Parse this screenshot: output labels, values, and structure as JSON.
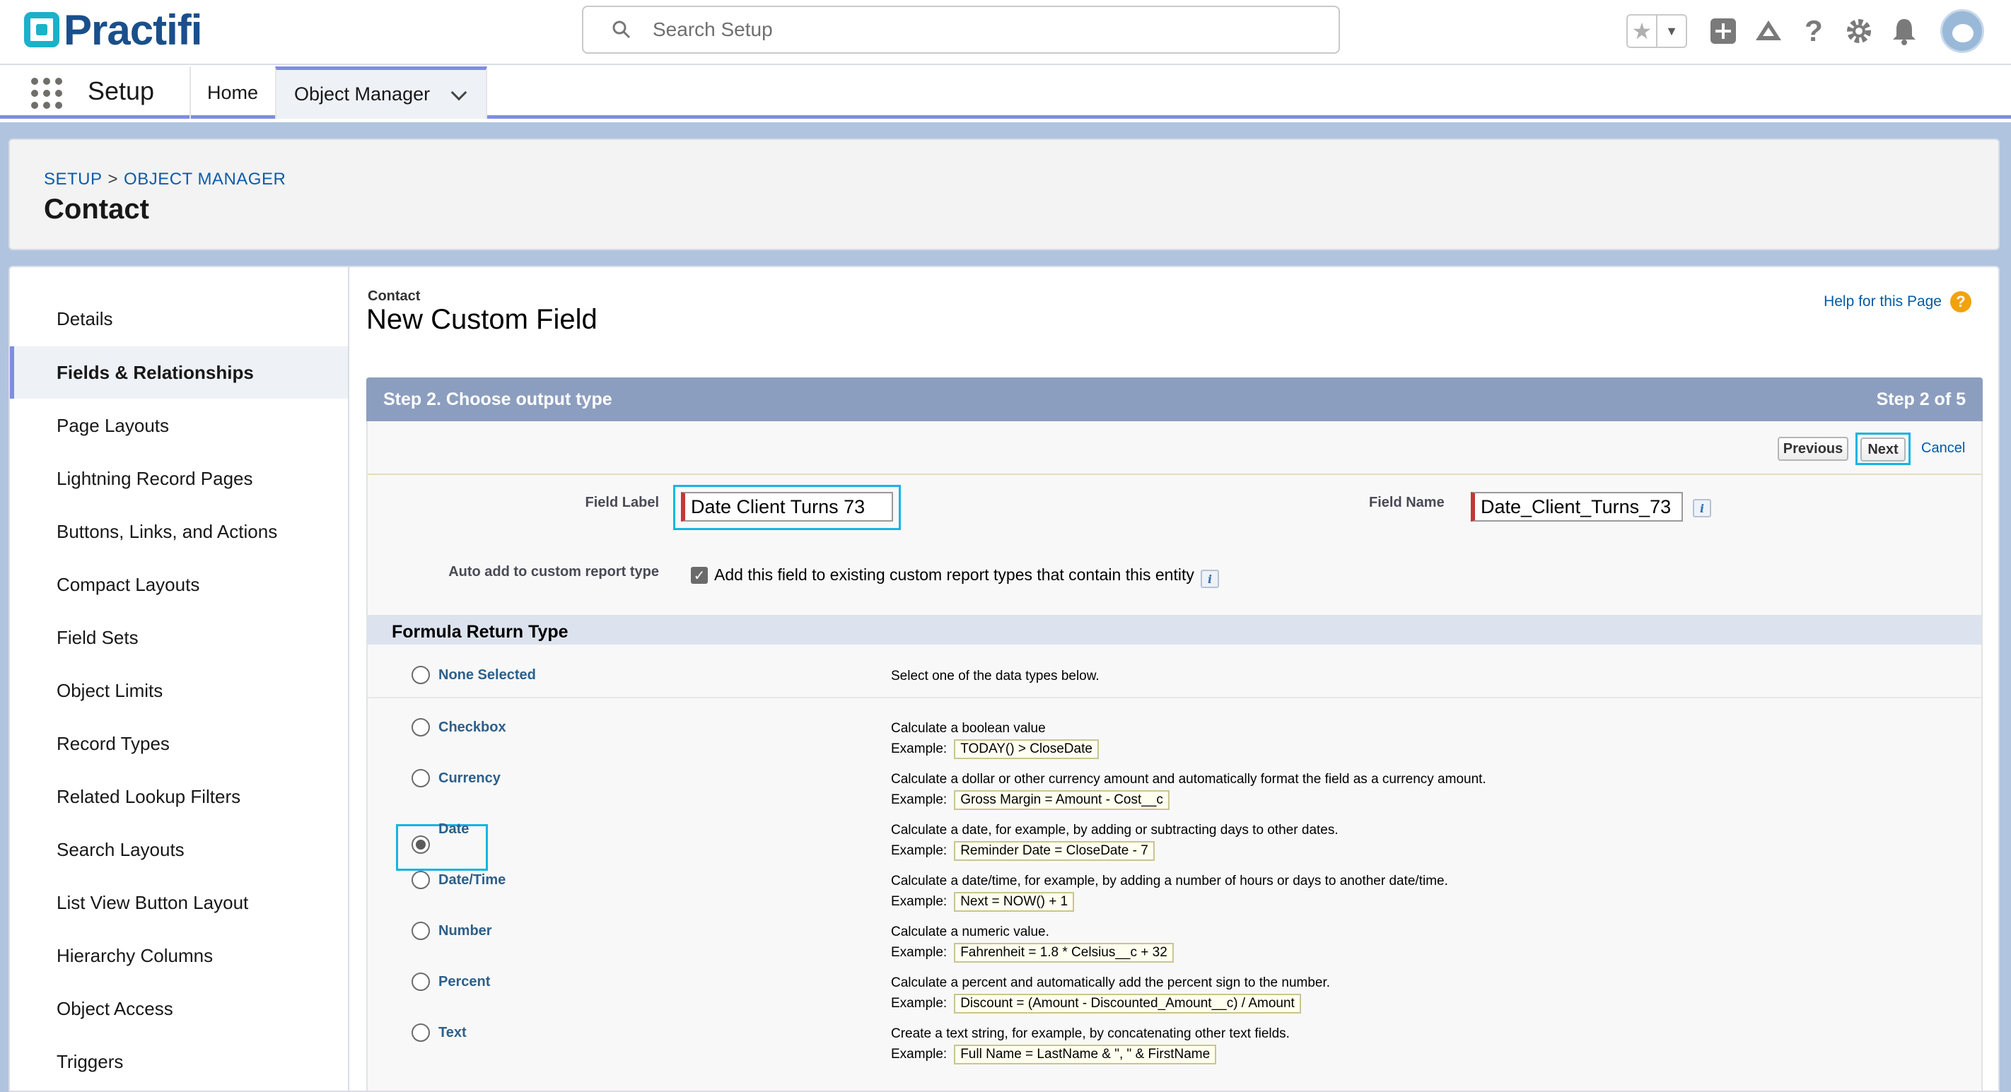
{
  "header": {
    "logo_text": "Practifi",
    "search_placeholder": "Search Setup",
    "icons": [
      "favorites-star-icon",
      "add-icon",
      "trailhead-icon",
      "help-icon",
      "gear-icon",
      "notification-bell-icon",
      "user-avatar"
    ]
  },
  "nav": {
    "app_name": "Setup",
    "tabs": [
      {
        "label": "Home"
      },
      {
        "label": "Object Manager"
      }
    ]
  },
  "page_header": {
    "breadcrumb_setup": "SETUP",
    "breadcrumb_sep": ">",
    "breadcrumb_om": "OBJECT MANAGER",
    "title": "Contact"
  },
  "sidebar": {
    "items": [
      {
        "label": "Details"
      },
      {
        "label": "Fields & Relationships"
      },
      {
        "label": "Page Layouts"
      },
      {
        "label": "Lightning Record Pages"
      },
      {
        "label": "Buttons, Links, and Actions"
      },
      {
        "label": "Compact Layouts"
      },
      {
        "label": "Field Sets"
      },
      {
        "label": "Object Limits"
      },
      {
        "label": "Record Types"
      },
      {
        "label": "Related Lookup Filters"
      },
      {
        "label": "Search Layouts"
      },
      {
        "label": "List View Button Layout"
      },
      {
        "label": "Hierarchy Columns"
      },
      {
        "label": "Object Access"
      },
      {
        "label": "Triggers"
      }
    ],
    "active_index": 1
  },
  "content": {
    "object": "Contact",
    "title": "New Custom Field",
    "help_link": "Help for this Page",
    "step_title": "Step 2. Choose output type",
    "step_count": "Step 2 of 5",
    "buttons": {
      "previous": "Previous",
      "next": "Next",
      "cancel": "Cancel"
    },
    "field_label_label": "Field Label",
    "field_label_value": "Date Client Turns 73",
    "field_name_label": "Field Name",
    "field_name_value": "Date_Client_Turns_73",
    "auto_add_label": "Auto add to custom report type",
    "auto_add_text": "Add this field to existing custom report types that contain this entity",
    "auto_add_checked": true,
    "frt_title": "Formula Return Type",
    "example_label": "Example:",
    "types": [
      {
        "name": "None Selected",
        "desc": "Select one of the data types below.",
        "example": ""
      },
      {
        "name": "Checkbox",
        "desc": "Calculate a boolean value",
        "example": "TODAY() > CloseDate"
      },
      {
        "name": "Currency",
        "desc": "Calculate a dollar or other currency amount and automatically format the field as a currency amount.",
        "example": "Gross Margin = Amount - Cost__c"
      },
      {
        "name": "Date",
        "desc": "Calculate a date, for example, by adding or subtracting days to other dates.",
        "example": "Reminder Date = CloseDate - 7"
      },
      {
        "name": "Date/Time",
        "desc": "Calculate a date/time, for example, by adding a number of hours or days to another date/time.",
        "example": "Next = NOW() + 1"
      },
      {
        "name": "Number",
        "desc": "Calculate a numeric value.",
        "example": "Fahrenheit = 1.8 * Celsius__c + 32"
      },
      {
        "name": "Percent",
        "desc": "Calculate a percent and automatically add the percent sign to the number.",
        "example": "Discount = (Amount - Discounted_Amount__c) / Amount"
      },
      {
        "name": "Text",
        "desc": "Create a text string, for example, by concatenating other text fields.",
        "example": "Full Name = LastName & \", \" & FirstName"
      }
    ],
    "selected_type": "Date"
  }
}
